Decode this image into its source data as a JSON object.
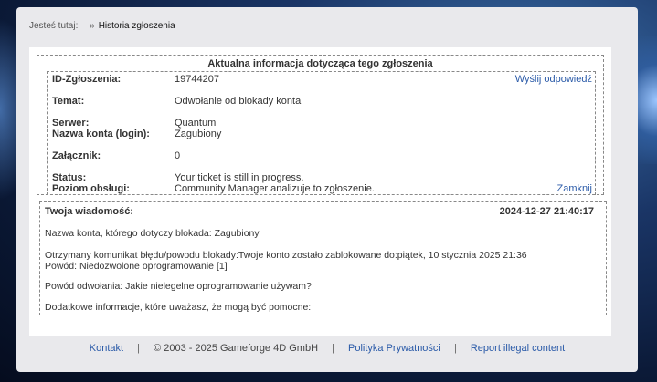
{
  "breadcrumb": {
    "prefix": "Jesteś tutaj:",
    "separator": "»",
    "current": "Historia zgłoszenia"
  },
  "ticket_box": {
    "title": "Aktualna informacja dotycząca tego zgłoszenia",
    "reply_link": "Wyślij odpowiedź",
    "close_link": "Zamknij",
    "fields": [
      {
        "label": "ID-Zgłoszenia:",
        "value": "19744207"
      },
      {
        "label": "Temat:",
        "value": "Odwołanie od blokady konta"
      },
      {
        "label": "Serwer:",
        "value": "Quantum"
      },
      {
        "label": "Nazwa konta (login):",
        "value": "Zagubiony"
      },
      {
        "label": "Załącznik:",
        "value": "0"
      },
      {
        "label": "Status:",
        "value": "Your ticket is still in progress."
      },
      {
        "label": "Poziom obsługi:",
        "value": "Community Manager analizuje to zgłoszenie."
      }
    ]
  },
  "message_box": {
    "heading": "Twoja wiadomość:",
    "date": "2024-12-27 21:40:17",
    "lines": [
      "Nazwa konta, którego dotyczy blokada: Zagubiony",
      "Otrzymany komunikat błędu/powodu blokady:Twoje konto zostało zablokowane do:piątek, 10 stycznia 2025 21:36",
      "Powód: Niedozwolone oprogramowanie [1]",
      "Powód odwołania: Jakie nielegelne oprogramowanie używam?",
      "Dodatkowe informacje, które uważasz, że mogą być pomocne:"
    ]
  },
  "footer": {
    "contact": "Kontakt",
    "copyright": "© 2003 - 2025 Gameforge 4D GmbH",
    "privacy": "Polityka Prywatności",
    "report": "Report illegal content",
    "separator": "|"
  }
}
